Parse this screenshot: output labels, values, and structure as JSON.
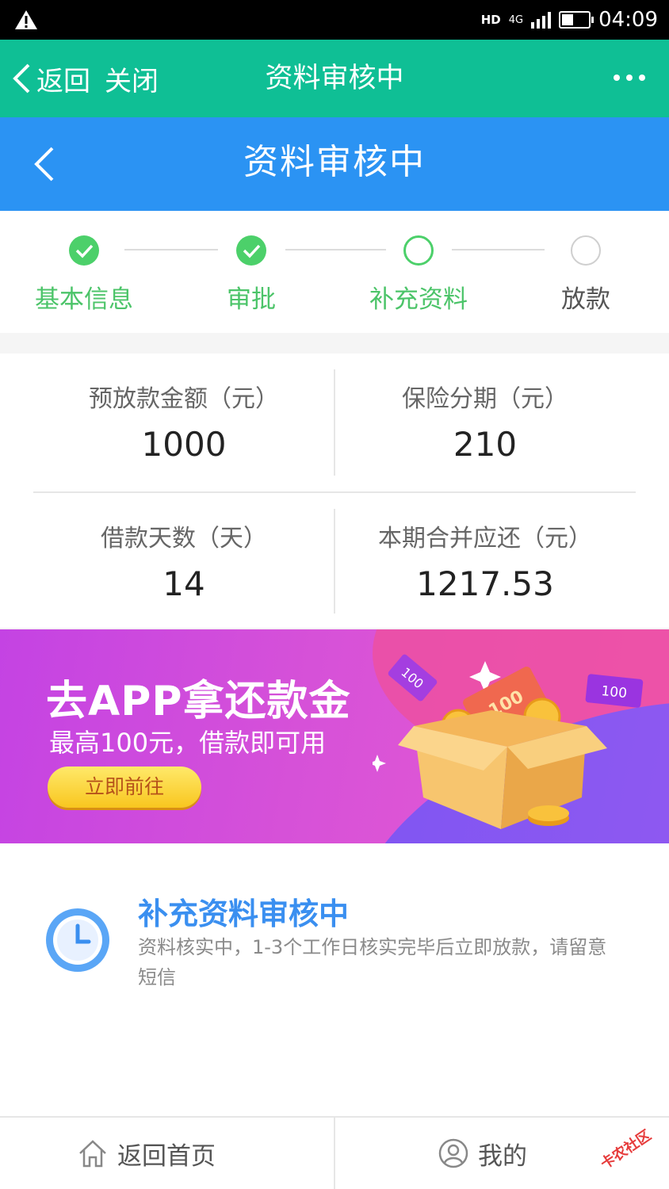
{
  "status_bar": {
    "hd": "HD",
    "network": "4G",
    "time": "04:09"
  },
  "app_header": {
    "back_label": "返回",
    "close_label": "关闭",
    "title": "资料审核中"
  },
  "page_header": {
    "title": "资料审核中"
  },
  "steps": [
    {
      "label": "基本信息",
      "state": "done"
    },
    {
      "label": "审批",
      "state": "done"
    },
    {
      "label": "补充资料",
      "state": "current"
    },
    {
      "label": "放款",
      "state": "pending"
    }
  ],
  "loan_summary": {
    "pre_disburse_amount_label": "预放款金额（元）",
    "pre_disburse_amount": "1000",
    "insurance_installment_label": "保险分期（元）",
    "insurance_installment": "210",
    "loan_days_label": "借款天数（天）",
    "loan_days": "14",
    "total_due_label": "本期合并应还（元）",
    "total_due": "1217.53"
  },
  "banner": {
    "headline": "去APP拿还款金",
    "subtitle": "最高100元，借款即可用",
    "button_label": "立即前往",
    "coupon_text": "100"
  },
  "review_notice": {
    "title": "补充资料审核中",
    "description": "资料核实中，1-3个工作日核实完毕后立即放款，请留意短信"
  },
  "tab_bar": {
    "home_label": "返回首页",
    "mine_label": "我的"
  },
  "watermark": "卡农社区",
  "colors": {
    "green_header": "#0fbf95",
    "blue_header": "#2b93f3",
    "step_green": "#4cd06a",
    "notice_blue": "#3a8ff0"
  }
}
